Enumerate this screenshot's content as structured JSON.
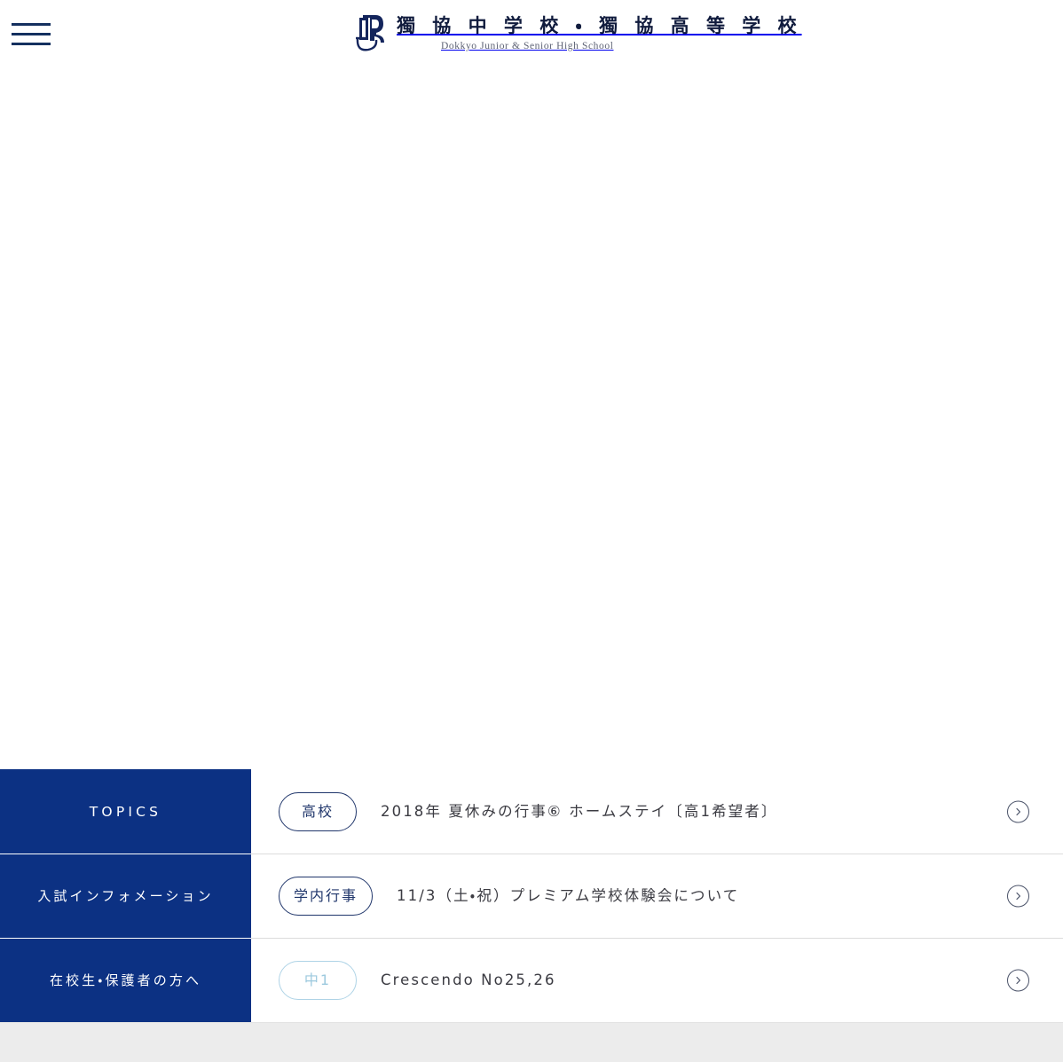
{
  "header": {
    "menu_icon": "hamburger-menu-icon",
    "logo": {
      "mark": "dokkyo-d-monogram-icon",
      "title_jp": "獨 協 中 学 校 ・ 獨 協 高 等 学 校",
      "title_en": "Dokkyo Junior & Senior High School"
    }
  },
  "news": {
    "rows": [
      {
        "category": "TOPICS",
        "category_style": "latin",
        "badge": "高校",
        "badge_style": "dark",
        "title": "2018年 夏休みの行事⑥ ホームステイ〔高1希望者〕",
        "arrow": "chevron-right-icon"
      },
      {
        "category": "入試インフォメーション",
        "category_style": "jp",
        "badge": "学内行事",
        "badge_style": "dark",
        "title": "11/3（土・祝）プレミアム学校体験会について",
        "arrow": "chevron-right-icon"
      },
      {
        "category": "在校生・保護者の方へ",
        "category_style": "jp",
        "badge": "中1",
        "badge_style": "light",
        "title": "Crescendo No25,26",
        "arrow": "chevron-right-icon"
      }
    ]
  },
  "colors": {
    "brand_blue": "#0c3183",
    "badge_navy": "#20366b",
    "badge_light_blue": "#aed3e6",
    "text_dark": "#3b3b42",
    "logo_navy": "#101b3d",
    "footer_gray": "#ececec"
  }
}
